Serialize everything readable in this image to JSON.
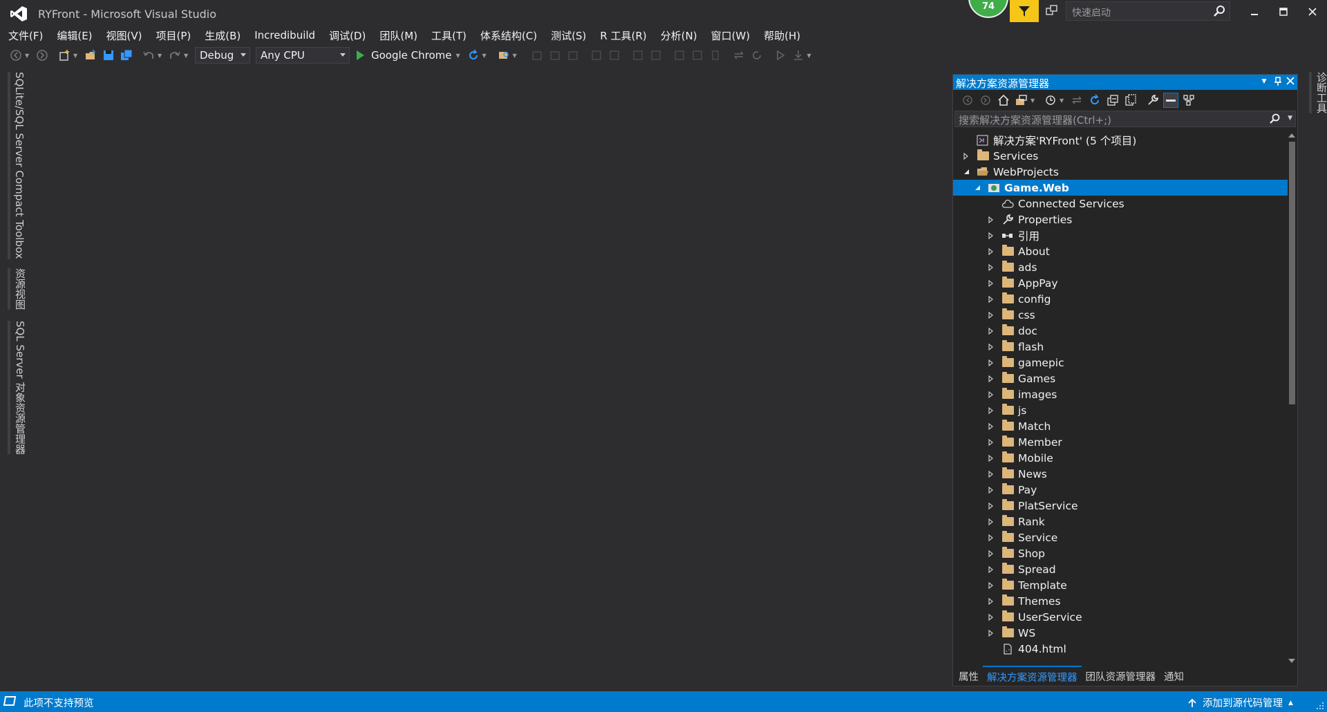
{
  "window": {
    "title": "RYFront - Microsoft Visual Studio",
    "perf_badge": "74",
    "quick_launch_placeholder": "快速启动"
  },
  "menu": [
    "文件(F)",
    "编辑(E)",
    "视图(V)",
    "项目(P)",
    "生成(B)",
    "Incredibuild",
    "调试(D)",
    "团队(M)",
    "工具(T)",
    "体系结构(C)",
    "测试(S)",
    "R 工具(R)",
    "分析(N)",
    "窗口(W)",
    "帮助(H)"
  ],
  "toolbar": {
    "config": "Debug",
    "platform": "Any CPU",
    "run_target": "Google Chrome"
  },
  "left_tabs": [
    "SQLite/SQL Server Compact Toolbox",
    "资源视图",
    "SQL Server 对象资源管理器"
  ],
  "right_tabs": [
    "诊断工具"
  ],
  "solution_explorer": {
    "title": "解决方案资源管理器",
    "search_placeholder": "搜索解决方案资源管理器(Ctrl+;)",
    "tree": [
      {
        "label": "解决方案'RYFront' (5 个项目)",
        "level": 0,
        "expander": "none",
        "icon": "solution-icon"
      },
      {
        "label": "Services",
        "level": 0,
        "expander": "collapsed",
        "icon": "folder-icon"
      },
      {
        "label": "WebProjects",
        "level": 0,
        "expander": "expanded",
        "icon": "open-folder-icon"
      },
      {
        "label": "Game.Web",
        "level": 1,
        "expander": "expanded",
        "icon": "web-project-icon",
        "selected": true
      },
      {
        "label": "Connected Services",
        "level": 2,
        "expander": "none",
        "icon": "cloud-icon"
      },
      {
        "label": "Properties",
        "level": 2,
        "expander": "collapsed",
        "icon": "wrench-icon"
      },
      {
        "label": "引用",
        "level": 2,
        "expander": "collapsed",
        "icon": "reference-icon"
      },
      {
        "label": "About",
        "level": 2,
        "expander": "collapsed",
        "icon": "folder-icon"
      },
      {
        "label": "ads",
        "level": 2,
        "expander": "collapsed",
        "icon": "folder-icon"
      },
      {
        "label": "AppPay",
        "level": 2,
        "expander": "collapsed",
        "icon": "folder-icon"
      },
      {
        "label": "config",
        "level": 2,
        "expander": "collapsed",
        "icon": "folder-icon"
      },
      {
        "label": "css",
        "level": 2,
        "expander": "collapsed",
        "icon": "folder-icon"
      },
      {
        "label": "doc",
        "level": 2,
        "expander": "collapsed",
        "icon": "folder-icon"
      },
      {
        "label": "flash",
        "level": 2,
        "expander": "collapsed",
        "icon": "folder-icon"
      },
      {
        "label": "gamepic",
        "level": 2,
        "expander": "collapsed",
        "icon": "folder-icon"
      },
      {
        "label": "Games",
        "level": 2,
        "expander": "collapsed",
        "icon": "folder-icon"
      },
      {
        "label": "images",
        "level": 2,
        "expander": "collapsed",
        "icon": "folder-icon"
      },
      {
        "label": "js",
        "level": 2,
        "expander": "collapsed",
        "icon": "folder-icon"
      },
      {
        "label": "Match",
        "level": 2,
        "expander": "collapsed",
        "icon": "folder-icon"
      },
      {
        "label": "Member",
        "level": 2,
        "expander": "collapsed",
        "icon": "folder-icon"
      },
      {
        "label": "Mobile",
        "level": 2,
        "expander": "collapsed",
        "icon": "folder-icon"
      },
      {
        "label": "News",
        "level": 2,
        "expander": "collapsed",
        "icon": "folder-icon"
      },
      {
        "label": "Pay",
        "level": 2,
        "expander": "collapsed",
        "icon": "folder-icon"
      },
      {
        "label": "PlatService",
        "level": 2,
        "expander": "collapsed",
        "icon": "folder-icon"
      },
      {
        "label": "Rank",
        "level": 2,
        "expander": "collapsed",
        "icon": "folder-icon"
      },
      {
        "label": "Service",
        "level": 2,
        "expander": "collapsed",
        "icon": "folder-icon"
      },
      {
        "label": "Shop",
        "level": 2,
        "expander": "collapsed",
        "icon": "folder-icon"
      },
      {
        "label": "Spread",
        "level": 2,
        "expander": "collapsed",
        "icon": "folder-icon"
      },
      {
        "label": "Template",
        "level": 2,
        "expander": "collapsed",
        "icon": "folder-icon"
      },
      {
        "label": "Themes",
        "level": 2,
        "expander": "collapsed",
        "icon": "folder-icon"
      },
      {
        "label": "UserService",
        "level": 2,
        "expander": "collapsed",
        "icon": "folder-icon"
      },
      {
        "label": "WS",
        "level": 2,
        "expander": "collapsed",
        "icon": "folder-icon"
      },
      {
        "label": "404.html",
        "level": 2,
        "expander": "none",
        "icon": "html-file-icon"
      }
    ],
    "bottom_tabs": [
      {
        "label": "属性",
        "active": false
      },
      {
        "label": "解决方案资源管理器",
        "active": true
      },
      {
        "label": "团队资源管理器",
        "active": false
      },
      {
        "label": "通知",
        "active": false
      }
    ]
  },
  "status": {
    "message": "此项不支持预览",
    "source_control": "添加到源代码管理"
  },
  "colors": {
    "accent": "#007acc",
    "background": "#2d2d30",
    "folder": "#dcb67a",
    "run": "#3fae49",
    "badge": "#3fae49",
    "filter": "#f5c518"
  }
}
